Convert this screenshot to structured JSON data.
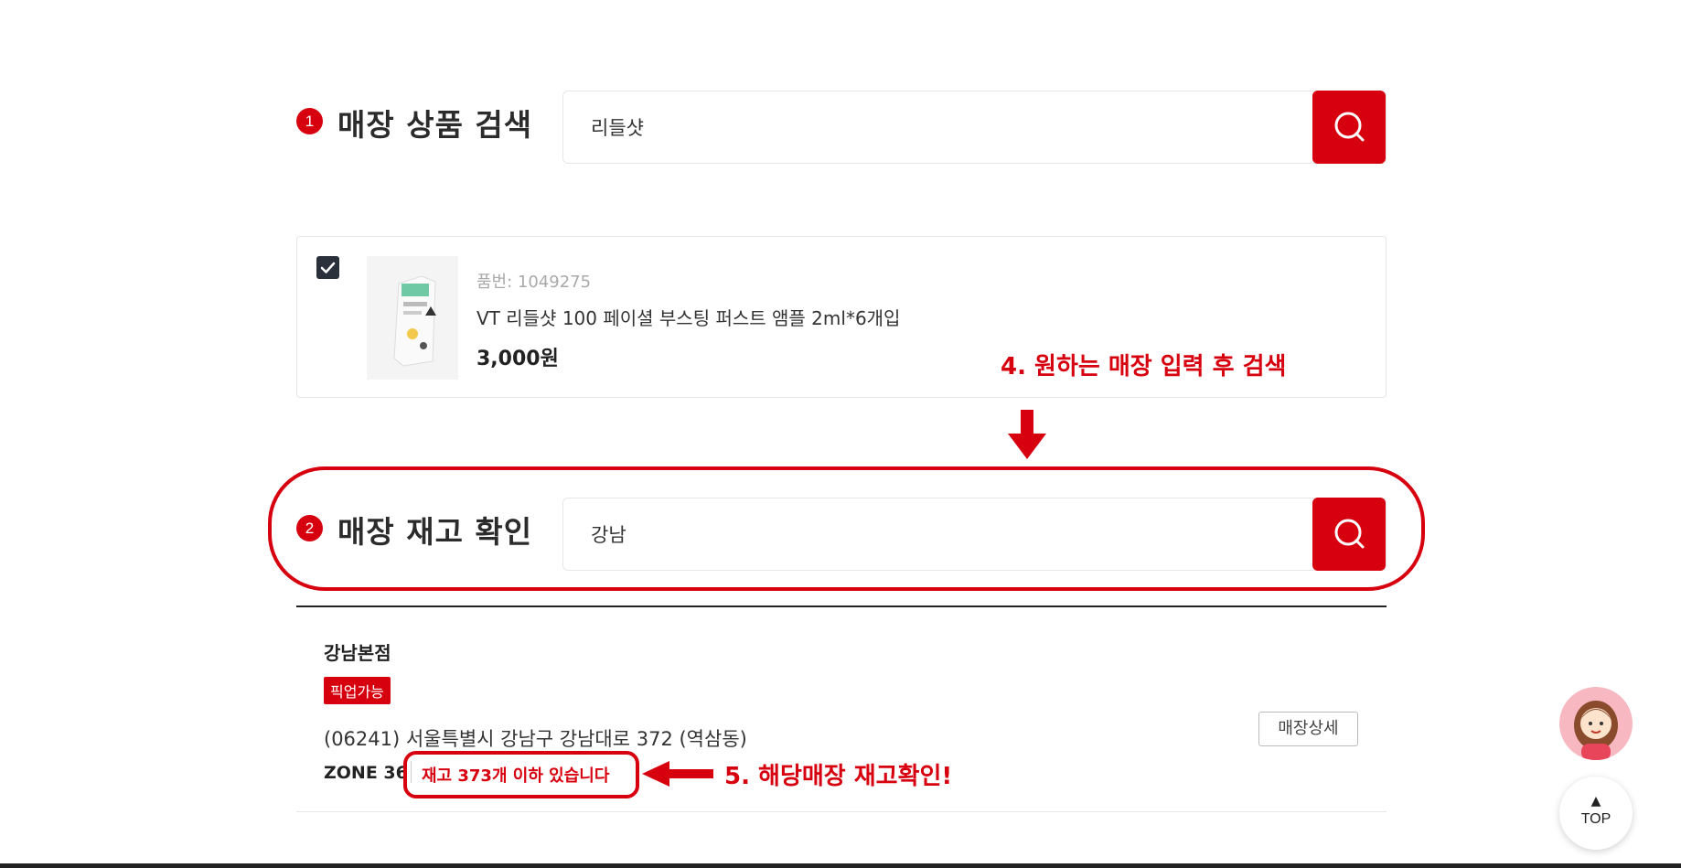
{
  "section1": {
    "number": "1",
    "title": "매장 상품 검색",
    "search_value": "리들샷",
    "search_button_icon": "search-icon"
  },
  "product": {
    "checked": true,
    "code_label": "품번: 1049275",
    "name": "VT 리들샷 100 페이셜 부스팅 퍼스트 앰플 2ml*6개입",
    "price": "3,000원"
  },
  "annotations": {
    "step4": "4. 원하는 매장 입력 후 검색",
    "step5": "5. 해당매장 재고확인!"
  },
  "section2": {
    "number": "2",
    "title": "매장 재고 확인",
    "search_value": "강남",
    "search_button_icon": "search-icon"
  },
  "store": {
    "name": "강남본점",
    "badge": "픽업가능",
    "address": "(06241) 서울특별시 강남구 강남대로 372 (역삼동)",
    "zone": "ZONE 36",
    "stock_text": "재고 373개 이하 있습니다",
    "detail_button": "매장상세"
  },
  "floating": {
    "top_label": "TOP"
  },
  "colors": {
    "brand_red": "#d7000f",
    "text_dark": "#2b2b2b"
  }
}
